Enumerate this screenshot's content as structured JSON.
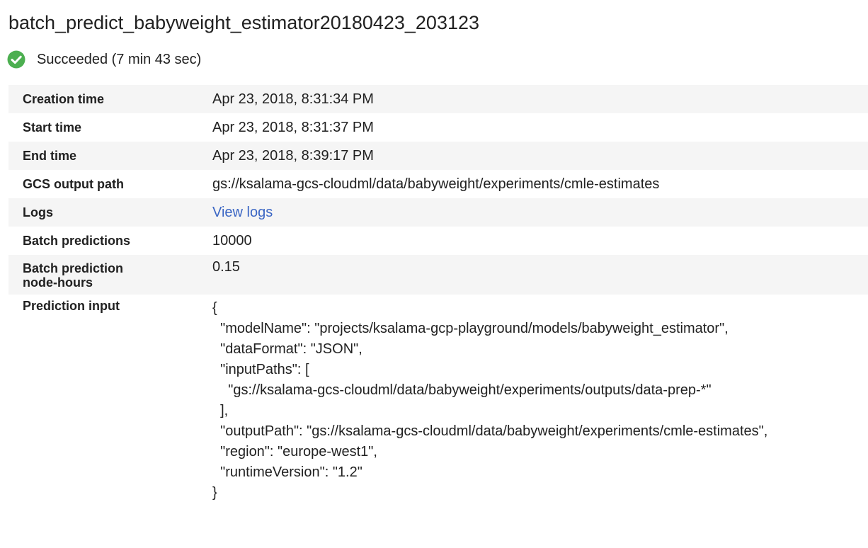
{
  "job": {
    "title": "batch_predict_babyweight_estimator20180423_203123",
    "status_text": "Succeeded (7 min 43 sec)",
    "status_color": "#4caf50",
    "status_icon": "check-circle-icon"
  },
  "details": {
    "creation_time": {
      "label": "Creation time",
      "value": "Apr 23, 2018, 8:31:34 PM"
    },
    "start_time": {
      "label": "Start time",
      "value": "Apr 23, 2018, 8:31:37 PM"
    },
    "end_time": {
      "label": "End time",
      "value": "Apr 23, 2018, 8:39:17 PM"
    },
    "gcs_output_path": {
      "label": "GCS output path",
      "value": "gs://ksalama-gcs-cloudml/data/babyweight/experiments/cmle-estimates"
    },
    "logs": {
      "label": "Logs",
      "value": "View logs",
      "link_color": "#3b66c4"
    },
    "batch_predictions": {
      "label": "Batch predictions",
      "value": "10000"
    },
    "node_hours": {
      "label": "Batch prediction\nnode-hours",
      "value": "0.15"
    },
    "prediction_input": {
      "label": "Prediction input",
      "value": "{\n  \"modelName\": \"projects/ksalama-gcp-playground/models/babyweight_estimator\",\n  \"dataFormat\": \"JSON\",\n  \"inputPaths\": [\n    \"gs://ksalama-gcs-cloudml/data/babyweight/experiments/outputs/data-prep-*\"\n  ],\n  \"outputPath\": \"gs://ksalama-gcs-cloudml/data/babyweight/experiments/cmle-estimates\",\n  \"region\": \"europe-west1\",\n  \"runtimeVersion\": \"1.2\"\n}"
    }
  }
}
